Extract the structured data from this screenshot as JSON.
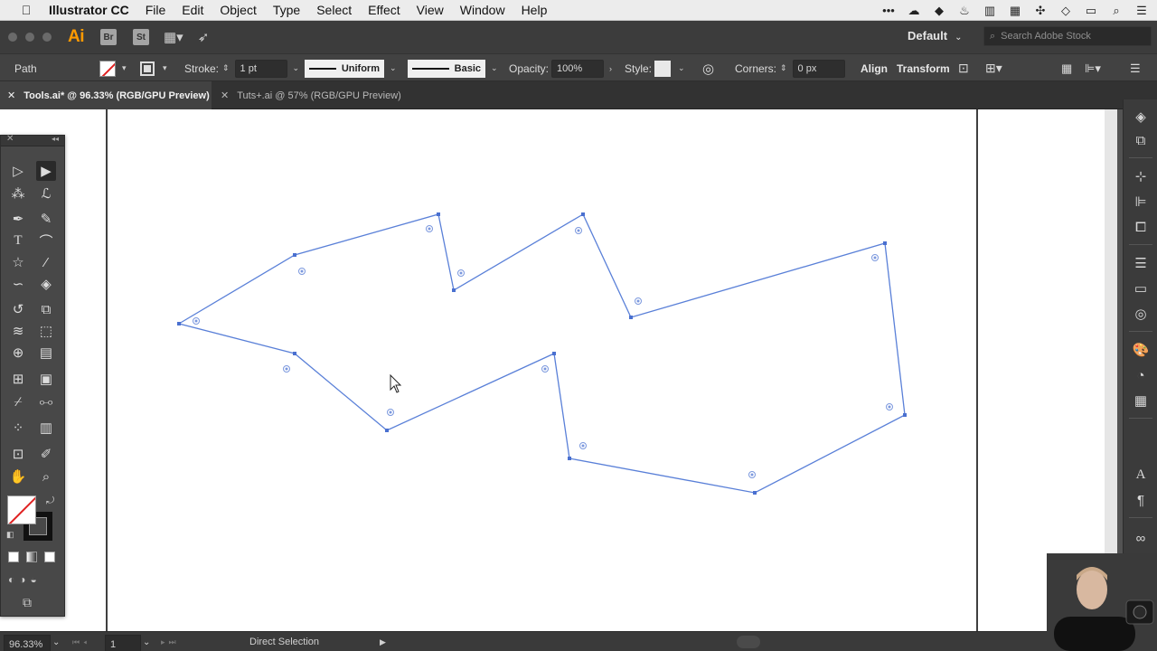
{
  "menubar": {
    "apple": "",
    "app_name": "Illustrator CC",
    "items": [
      "File",
      "Edit",
      "Object",
      "Type",
      "Select",
      "Effect",
      "View",
      "Window",
      "Help"
    ],
    "tray_icons": [
      "more-icon",
      "cloud-icon",
      "dropbox-icon",
      "flame-icon",
      "split-icon",
      "calendar-icon",
      "move-icon",
      "gem-icon",
      "battery-icon",
      "search-icon",
      "list-icon"
    ]
  },
  "appbar": {
    "logo": "Ai",
    "badges": [
      "Br",
      "St"
    ],
    "workspace": "Default",
    "stock_placeholder": "Search Adobe Stock"
  },
  "controlbar": {
    "selection_type": "Path",
    "stroke_label": "Stroke:",
    "stroke_value": "1 pt",
    "profile_uniform": "Uniform",
    "brush_basic": "Basic",
    "opacity_label": "Opacity:",
    "opacity_value": "100%",
    "style_label": "Style:",
    "corners_label": "Corners:",
    "corners_value": "0 px",
    "align": "Align",
    "transform": "Transform"
  },
  "tabs": [
    {
      "label": "Tools.ai* @ 96.33% (RGB/GPU Preview)",
      "active": true
    },
    {
      "label": "Tuts+.ai @ 57% (RGB/GPU Preview)",
      "active": false
    }
  ],
  "tools": {
    "items": [
      "selection-tool",
      "direct-selection-tool",
      "magic-wand-tool",
      "lasso-tool",
      "pen-tool",
      "curvature-tool",
      "type-tool",
      "arc-tool",
      "star-tool",
      "paintbrush-tool",
      "shaper-tool",
      "eraser-tool",
      "rotate-tool",
      "scale-tool",
      "width-tool",
      "free-transform-tool",
      "shape-builder-tool",
      "perspective-grid-tool",
      "mesh-tool",
      "gradient-tool",
      "eyedropper-tool",
      "blend-tool",
      "symbol-sprayer-tool",
      "column-graph-tool",
      "artboard-tool",
      "slice-tool",
      "hand-tool",
      "zoom-tool"
    ],
    "active_tool": "direct-selection-tool"
  },
  "statusbar": {
    "zoom": "96.33%",
    "artboard": "1",
    "current_tool": "Direct Selection"
  },
  "colors": {
    "path_stroke": "#5a80d8",
    "anchor": "#4a70d0",
    "none_red": "#e02020",
    "ai_orange": "#ff9a00"
  }
}
